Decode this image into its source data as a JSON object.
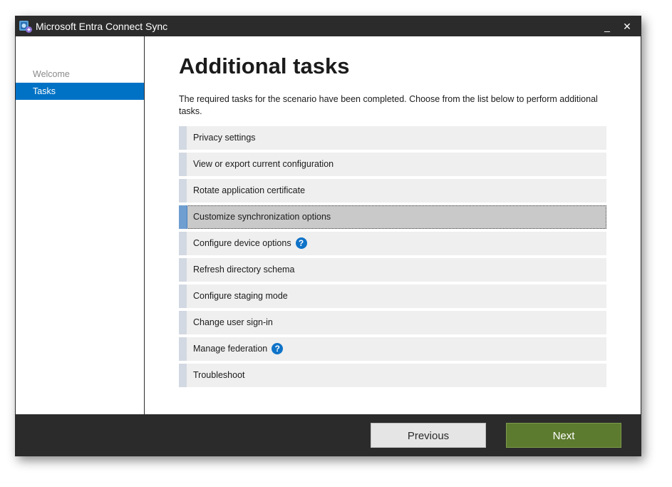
{
  "window": {
    "title": "Microsoft Entra Connect Sync",
    "minimize_glyph": "_",
    "close_glyph": "✕"
  },
  "sidebar": {
    "items": [
      {
        "label": "Welcome",
        "state": "completed"
      },
      {
        "label": "Tasks",
        "state": "active"
      }
    ]
  },
  "main": {
    "title": "Additional tasks",
    "description": "The required tasks for the scenario have been completed. Choose from the list below to perform additional tasks.",
    "tasks": [
      {
        "label": "Privacy settings",
        "help": false,
        "selected": false
      },
      {
        "label": "View or export current configuration",
        "help": false,
        "selected": false
      },
      {
        "label": "Rotate application certificate",
        "help": false,
        "selected": false
      },
      {
        "label": "Customize synchronization options",
        "help": false,
        "selected": true
      },
      {
        "label": "Configure device options",
        "help": true,
        "selected": false
      },
      {
        "label": "Refresh directory schema",
        "help": false,
        "selected": false
      },
      {
        "label": "Configure staging mode",
        "help": false,
        "selected": false
      },
      {
        "label": "Change user sign-in",
        "help": false,
        "selected": false
      },
      {
        "label": "Manage federation",
        "help": true,
        "selected": false
      },
      {
        "label": "Troubleshoot",
        "help": false,
        "selected": false
      }
    ],
    "help_glyph": "?"
  },
  "footer": {
    "previous_label": "Previous",
    "next_label": "Next"
  },
  "colors": {
    "titlebar": "#2b2b2b",
    "nav_active": "#0072c6",
    "next_button": "#5d7b2f",
    "help_icon": "#0f73c8"
  }
}
